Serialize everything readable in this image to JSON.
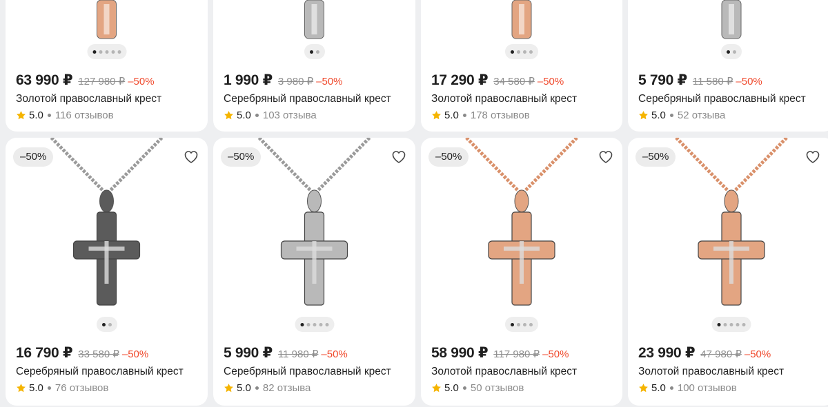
{
  "cards": [
    {
      "price": "63 990 ₽",
      "old_price": "127 980 ₽",
      "discount": "–50%",
      "title": "Золотой православный крест",
      "rating": "5.0",
      "reviews": "116 отзывов",
      "metal": "gold",
      "slides": 5
    },
    {
      "price": "1 990 ₽",
      "old_price": "3 980 ₽",
      "discount": "–50%",
      "title": "Серебряный православный крест",
      "rating": "5.0",
      "reviews": "103 отзыва",
      "metal": "silver",
      "slides": 2
    },
    {
      "price": "17 290 ₽",
      "old_price": "34 580 ₽",
      "discount": "–50%",
      "title": "Золотой православный крест",
      "rating": "5.0",
      "reviews": "178 отзывов",
      "metal": "gold",
      "slides": 4
    },
    {
      "price": "5 790 ₽",
      "old_price": "11 580 ₽",
      "discount": "–50%",
      "title": "Серебряный православный крест",
      "rating": "5.0",
      "reviews": "52 отзыва",
      "metal": "silver",
      "slides": 2
    },
    {
      "badge": "–50%",
      "price": "16 790 ₽",
      "old_price": "33 580 ₽",
      "discount": "–50%",
      "title": "Серебряный православный крест",
      "rating": "5.0",
      "reviews": "76 отзывов",
      "metal": "dark-silver",
      "slides": 2
    },
    {
      "badge": "–50%",
      "price": "5 990 ₽",
      "old_price": "11 980 ₽",
      "discount": "–50%",
      "title": "Серебряный православный крест",
      "rating": "5.0",
      "reviews": "82 отзыва",
      "metal": "silver",
      "slides": 5
    },
    {
      "badge": "–50%",
      "price": "58 990 ₽",
      "old_price": "117 980 ₽",
      "discount": "–50%",
      "title": "Золотой православный крест",
      "rating": "5.0",
      "reviews": "50 отзывов",
      "metal": "gold",
      "slides": 4
    },
    {
      "badge": "–50%",
      "price": "23 990 ₽",
      "old_price": "47 980 ₽",
      "discount": "–50%",
      "title": "Золотой православный крест",
      "rating": "5.0",
      "reviews": "100 отзывов",
      "metal": "gold",
      "slides": 5
    }
  ],
  "colors": {
    "gold": "#e3a582",
    "silver": "#b9b9b9",
    "dark-silver": "#5b5b5b",
    "discount": "#f0492c",
    "star": "#f5b400"
  },
  "icons": {
    "favorite": "heart-icon",
    "rating": "star-icon"
  }
}
